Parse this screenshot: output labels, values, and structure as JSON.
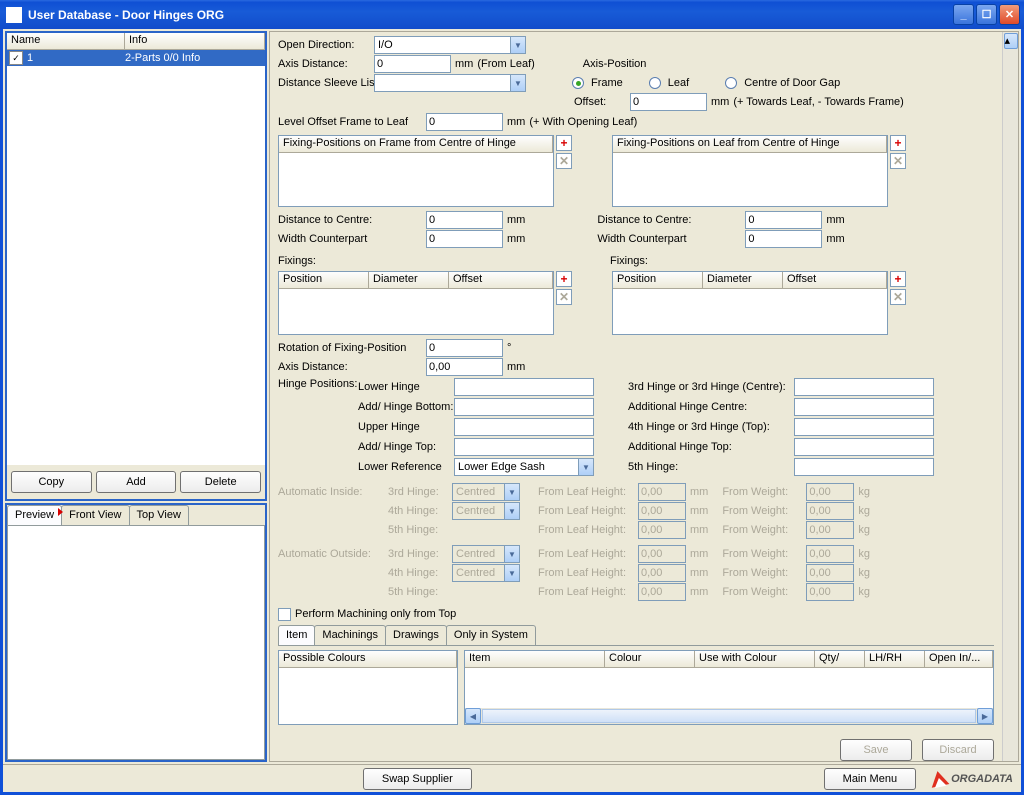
{
  "window": {
    "title": "User Database - Door Hinges ORG"
  },
  "left": {
    "headers": {
      "name": "Name",
      "info": "Info"
    },
    "row": {
      "name": "1",
      "info": "2-Parts 0/0 Info"
    },
    "buttons": {
      "copy": "Copy",
      "add": "Add",
      "delete": "Delete"
    },
    "tabs": {
      "preview": "Preview",
      "front": "Front View",
      "top": "Top View"
    }
  },
  "form": {
    "open_direction": {
      "label": "Open Direction:",
      "value": "I/O"
    },
    "axis_distance": {
      "label": "Axis Distance:",
      "value": "0",
      "unit": "mm",
      "extra": "(From Leaf)"
    },
    "sleeve": {
      "label": "Distance Sleeve List"
    },
    "axis_position": {
      "title": "Axis-Position",
      "frame": "Frame",
      "leaf": "Leaf",
      "centre": "Centre of Door Gap",
      "offset_label": "Offset:",
      "offset_value": "0",
      "offset_unit": "mm",
      "offset_note": "(+ Towards Leaf, - Towards Frame)"
    },
    "level_offset": {
      "label": "Level Offset Frame to Leaf",
      "value": "0",
      "unit": "mm",
      "note": "(+ With Opening Leaf)"
    },
    "fix_frame": {
      "title": "Fixing-Positions on Frame from Centre of Hinge"
    },
    "fix_leaf": {
      "title": "Fixing-Positions on Leaf from Centre of Hinge"
    },
    "dist_centre": {
      "label": "Distance to Centre:",
      "value": "0",
      "unit": "mm"
    },
    "width_cp": {
      "label": "Width Counterpart",
      "value": "0",
      "unit": "mm"
    },
    "fixings": {
      "label": "Fixings:",
      "cols": {
        "pos": "Position",
        "dia": "Diameter",
        "off": "Offset"
      }
    },
    "rotation": {
      "label": "Rotation of Fixing-Position",
      "value": "0",
      "unit": "°"
    },
    "axis_distance2": {
      "label": "Axis Distance:",
      "value": "0,00",
      "unit": "mm"
    },
    "hinge_positions": {
      "title": "Hinge Positions:",
      "lower": "Lower Hinge",
      "add_bottom": "Add/ Hinge Bottom:",
      "upper": "Upper Hinge",
      "add_top": "Add/ Hinge Top:",
      "lower_ref": "Lower Reference",
      "lower_ref_val": "Lower Edge Sash",
      "third": "3rd Hinge or 3rd Hinge (Centre):",
      "add_centre": "Additional Hinge Centre:",
      "fourth": "4th Hinge or 3rd Hinge (Top):",
      "add_top2": "Additional Hinge Top:",
      "fifth": "5th Hinge:"
    },
    "auto_inside": "Automatic Inside:",
    "auto_outside": "Automatic Outside:",
    "auto_rows": {
      "h3": "3rd Hinge:",
      "h4": "4th Hinge:",
      "h5": "5th Hinge:",
      "centred": "Centred",
      "leaf_h": "From Leaf Height:",
      "leaf_v": "0,00",
      "weight": "From Weight:",
      "weight_v": "0,00",
      "mm": "mm",
      "kg": "kg"
    },
    "perform": "Perform Machining only from Top",
    "sub_tabs": {
      "item": "Item",
      "mach": "Machinings",
      "draw": "Drawings",
      "sys": "Only in System"
    },
    "sub_left": {
      "title": "Possible Colours"
    },
    "sub_right": {
      "cols": {
        "item": "Item",
        "colour": "Colour",
        "use": "Use with Colour",
        "qty": "Qty/",
        "lhrh": "LH/RH",
        "open": "Open In/..."
      }
    },
    "save": "Save",
    "discard": "Discard"
  },
  "footer": {
    "swap": "Swap Supplier",
    "main": "Main Menu",
    "brand": "ORGADATA"
  }
}
